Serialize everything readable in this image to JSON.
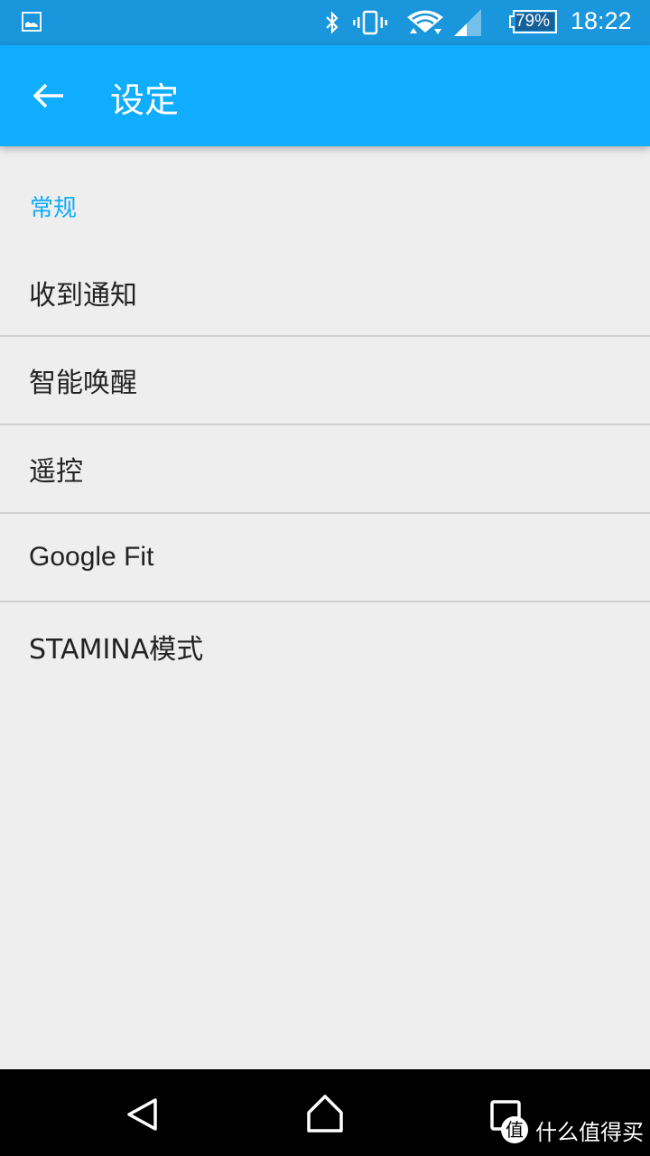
{
  "status_bar": {
    "left_icon": "image-notification-icon",
    "icons": [
      "bluetooth-icon",
      "vibrate-icon",
      "wifi-icon",
      "cell-signal-icon"
    ],
    "battery_percent": "79%",
    "time": "18:22"
  },
  "app_bar": {
    "back_icon": "arrow-back-icon",
    "title": "设定"
  },
  "settings": {
    "section_header": "常规",
    "items": [
      {
        "label": "收到通知"
      },
      {
        "label": "智能唤醒"
      },
      {
        "label": "遥控"
      },
      {
        "label": "Google Fit"
      },
      {
        "label": "STAMINA模式"
      }
    ]
  },
  "nav_bar": {
    "buttons": [
      "back-icon",
      "home-icon",
      "recents-icon"
    ]
  },
  "watermark": {
    "badge": "值",
    "text": "什么值得买"
  },
  "colors": {
    "status_bar": "#1996dc",
    "app_bar": "#10adfe",
    "accent": "#10adfe",
    "background": "#eeeeee",
    "divider": "#d0d0d0",
    "text_primary": "#222222"
  }
}
